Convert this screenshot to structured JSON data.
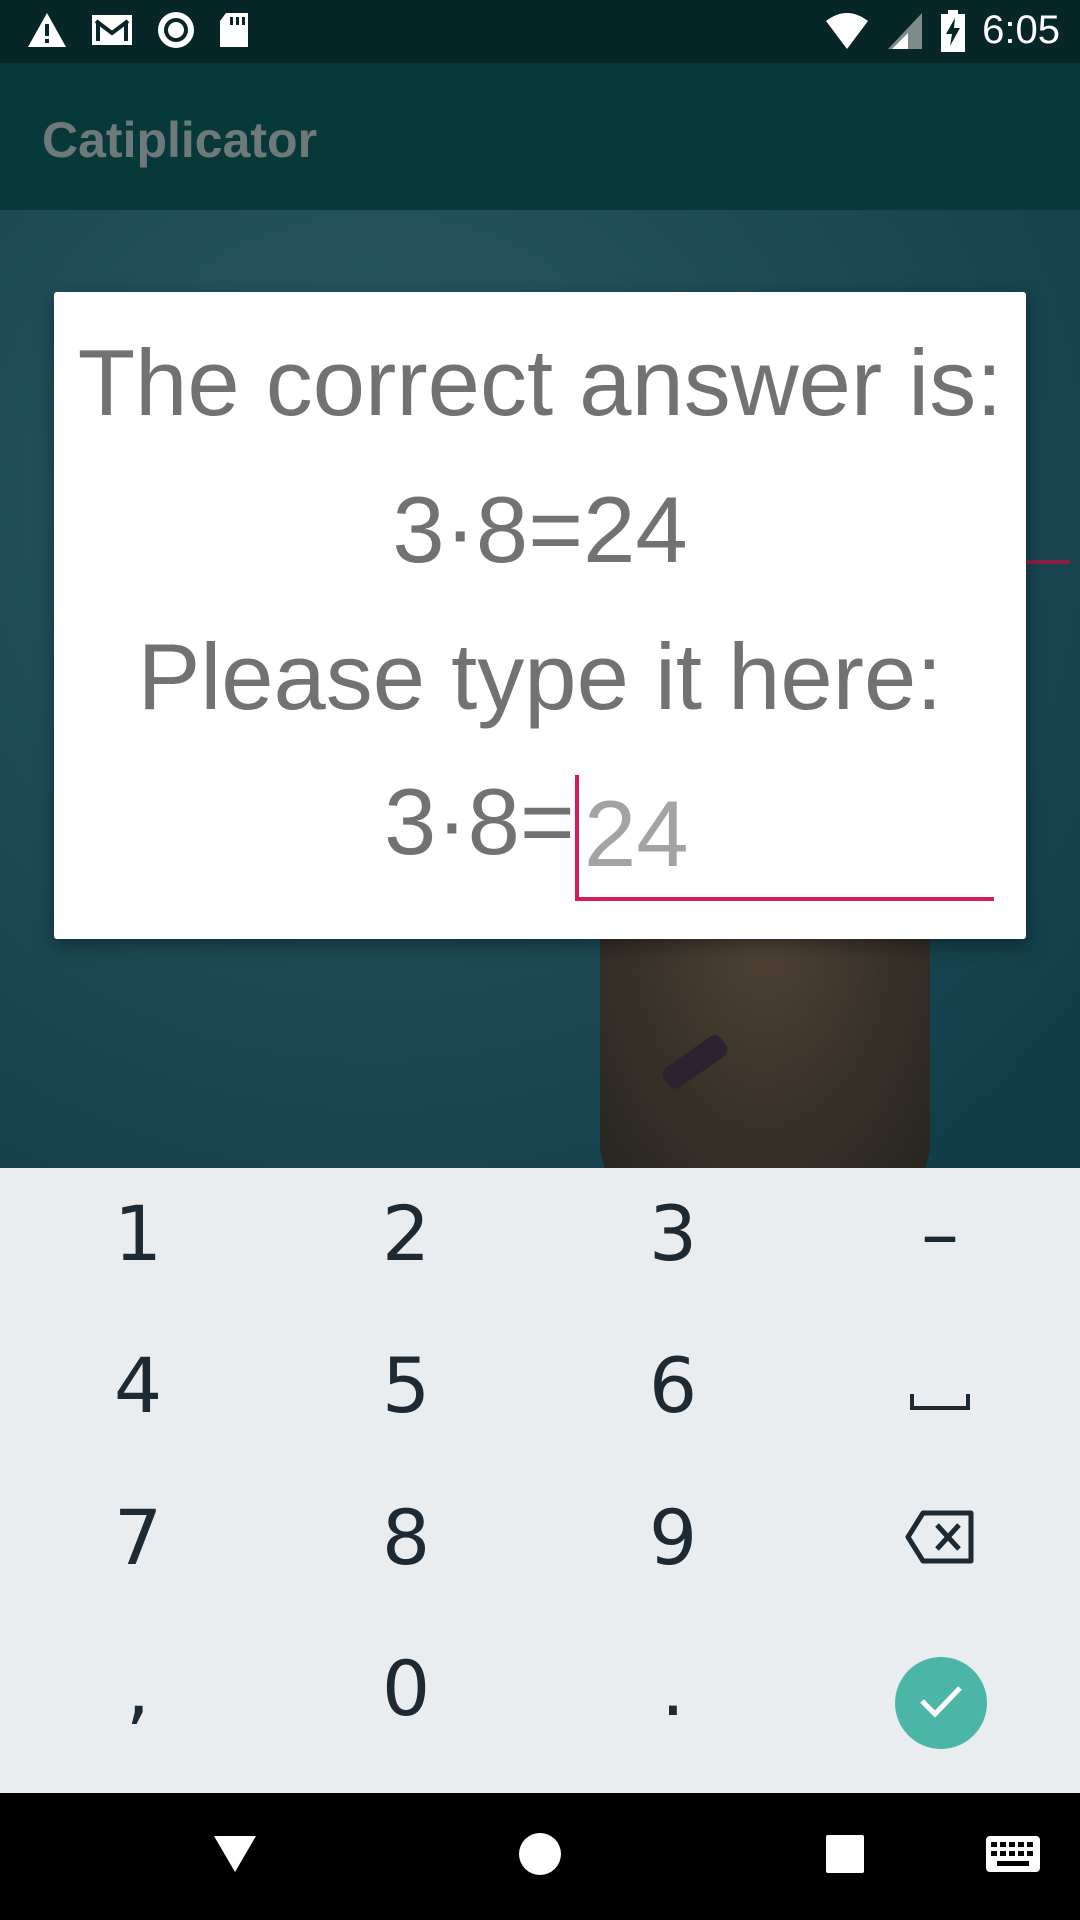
{
  "status_bar": {
    "time": "6:05",
    "icons_left": [
      "warning-icon",
      "gmail-icon",
      "record-icon",
      "sd-card-icon"
    ],
    "icons_right": [
      "wifi-icon",
      "signal-icon",
      "battery-charging-icon"
    ]
  },
  "app_bar": {
    "title": "Catiplicator"
  },
  "dialog": {
    "line1": "The correct answer is:",
    "line2": "3·8=24",
    "line3": "Please type it here:",
    "answer_prefix": "3·8=",
    "answer_value": "",
    "answer_placeholder": "24"
  },
  "keyboard": {
    "row1": [
      "1",
      "2",
      "3",
      "–"
    ],
    "row2": [
      "4",
      "5",
      "6",
      "␣"
    ],
    "row3": [
      "7",
      "8",
      "9",
      "backspace"
    ],
    "row4": [
      ",",
      "0",
      ".",
      "done"
    ],
    "accent_color": "#4bb6a8"
  },
  "nav_bar": {
    "items": [
      "back-icon",
      "home-icon",
      "recents-icon",
      "keyboard-icon"
    ]
  },
  "colors": {
    "accent": "#d81b60",
    "app_bar": "#08393a",
    "status_bar": "#062628"
  }
}
